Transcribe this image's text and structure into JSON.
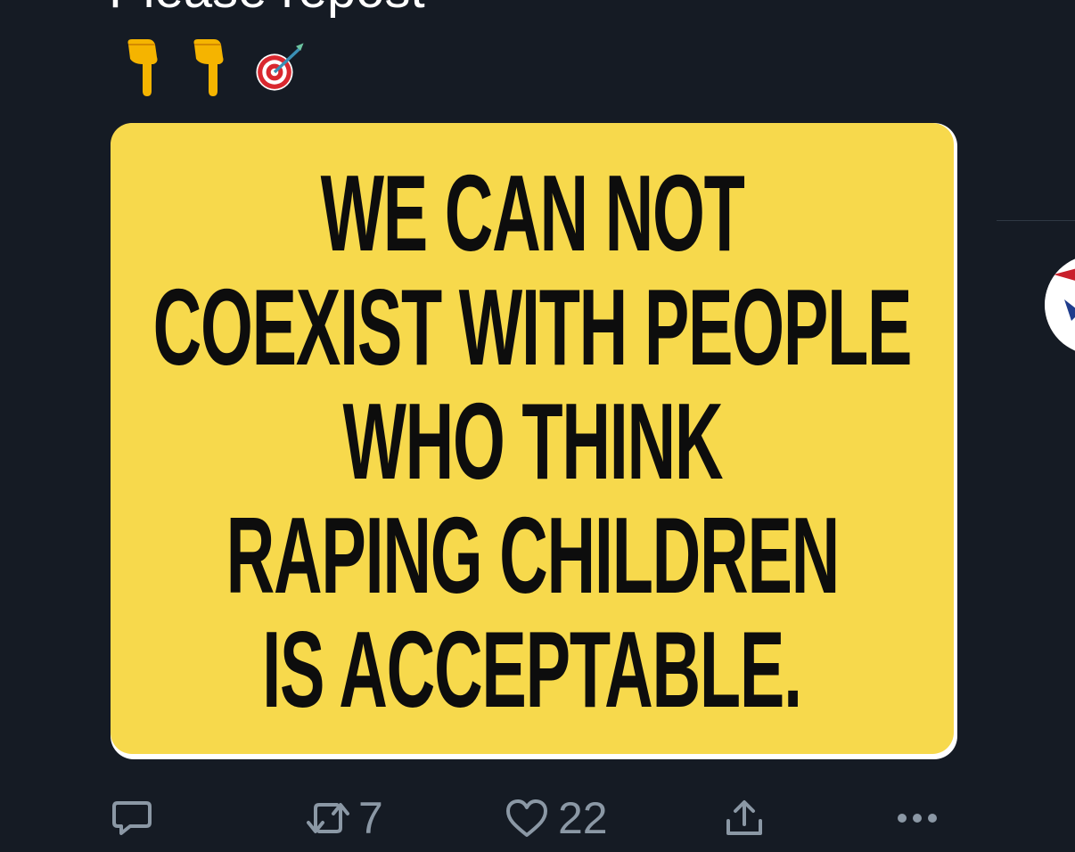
{
  "tweet": {
    "text": "Please repost",
    "emojis": [
      "backhand-index-pointing-down-icon",
      "backhand-index-pointing-down-icon",
      "direct-hit-icon"
    ]
  },
  "media": {
    "lines": [
      "WE CAN NOT",
      "COEXIST WITH PEOPLE",
      "WHO THINK",
      "RAPING CHILDREN",
      "IS ACCEPTABLE."
    ],
    "background_color": "#f7d94c",
    "text_color": "#0d0d0d"
  },
  "actions": {
    "reply_icon": "reply-icon",
    "retweet_icon": "retweet-icon",
    "retweet_count": "7",
    "like_icon": "heart-icon",
    "like_count": "22",
    "share_icon": "share-icon",
    "more_icon": "more-icon"
  },
  "theme": {
    "background": "#151b24",
    "icon_color": "#8b98a5"
  }
}
